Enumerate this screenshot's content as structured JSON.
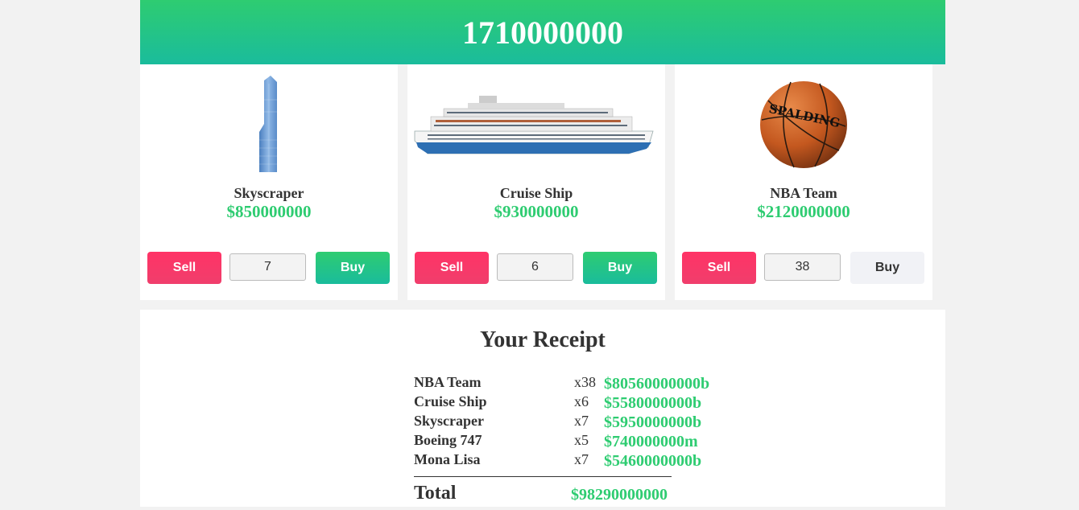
{
  "balance": "1710000000",
  "items": [
    {
      "name": "Skyscraper",
      "price": "$850000000",
      "quantity": "7",
      "sell_label": "Sell",
      "buy_label": "Buy",
      "image": "skyscraper-image",
      "buy_enabled": true
    },
    {
      "name": "Cruise Ship",
      "price": "$930000000",
      "quantity": "6",
      "sell_label": "Sell",
      "buy_label": "Buy",
      "image": "cruise-ship-image",
      "buy_enabled": true
    },
    {
      "name": "NBA Team",
      "price": "$2120000000",
      "quantity": "38",
      "sell_label": "Sell",
      "buy_label": "Buy",
      "image": "basketball-image",
      "buy_enabled": false
    }
  ],
  "receipt": {
    "title": "Your Receipt",
    "rows": [
      {
        "name": "NBA Team",
        "qty": "x38",
        "total": "$80560000000b"
      },
      {
        "name": "Cruise Ship",
        "qty": "x6",
        "total": "$5580000000b"
      },
      {
        "name": "Skyscraper",
        "qty": "x7",
        "total": "$5950000000b"
      },
      {
        "name": "Boeing 747",
        "qty": "x5",
        "total": "$740000000m"
      },
      {
        "name": "Mona Lisa",
        "qty": "x7",
        "total": "$5460000000b"
      }
    ],
    "total_label": "Total",
    "total_value": "$98290000000"
  },
  "colors": {
    "accent_green": "#2ecc71",
    "accent_teal": "#1abc9c",
    "sell_pink": "#ff3366",
    "disabled_gray": "#f1f2f6"
  },
  "spalding_logo_text": "SPALDING"
}
